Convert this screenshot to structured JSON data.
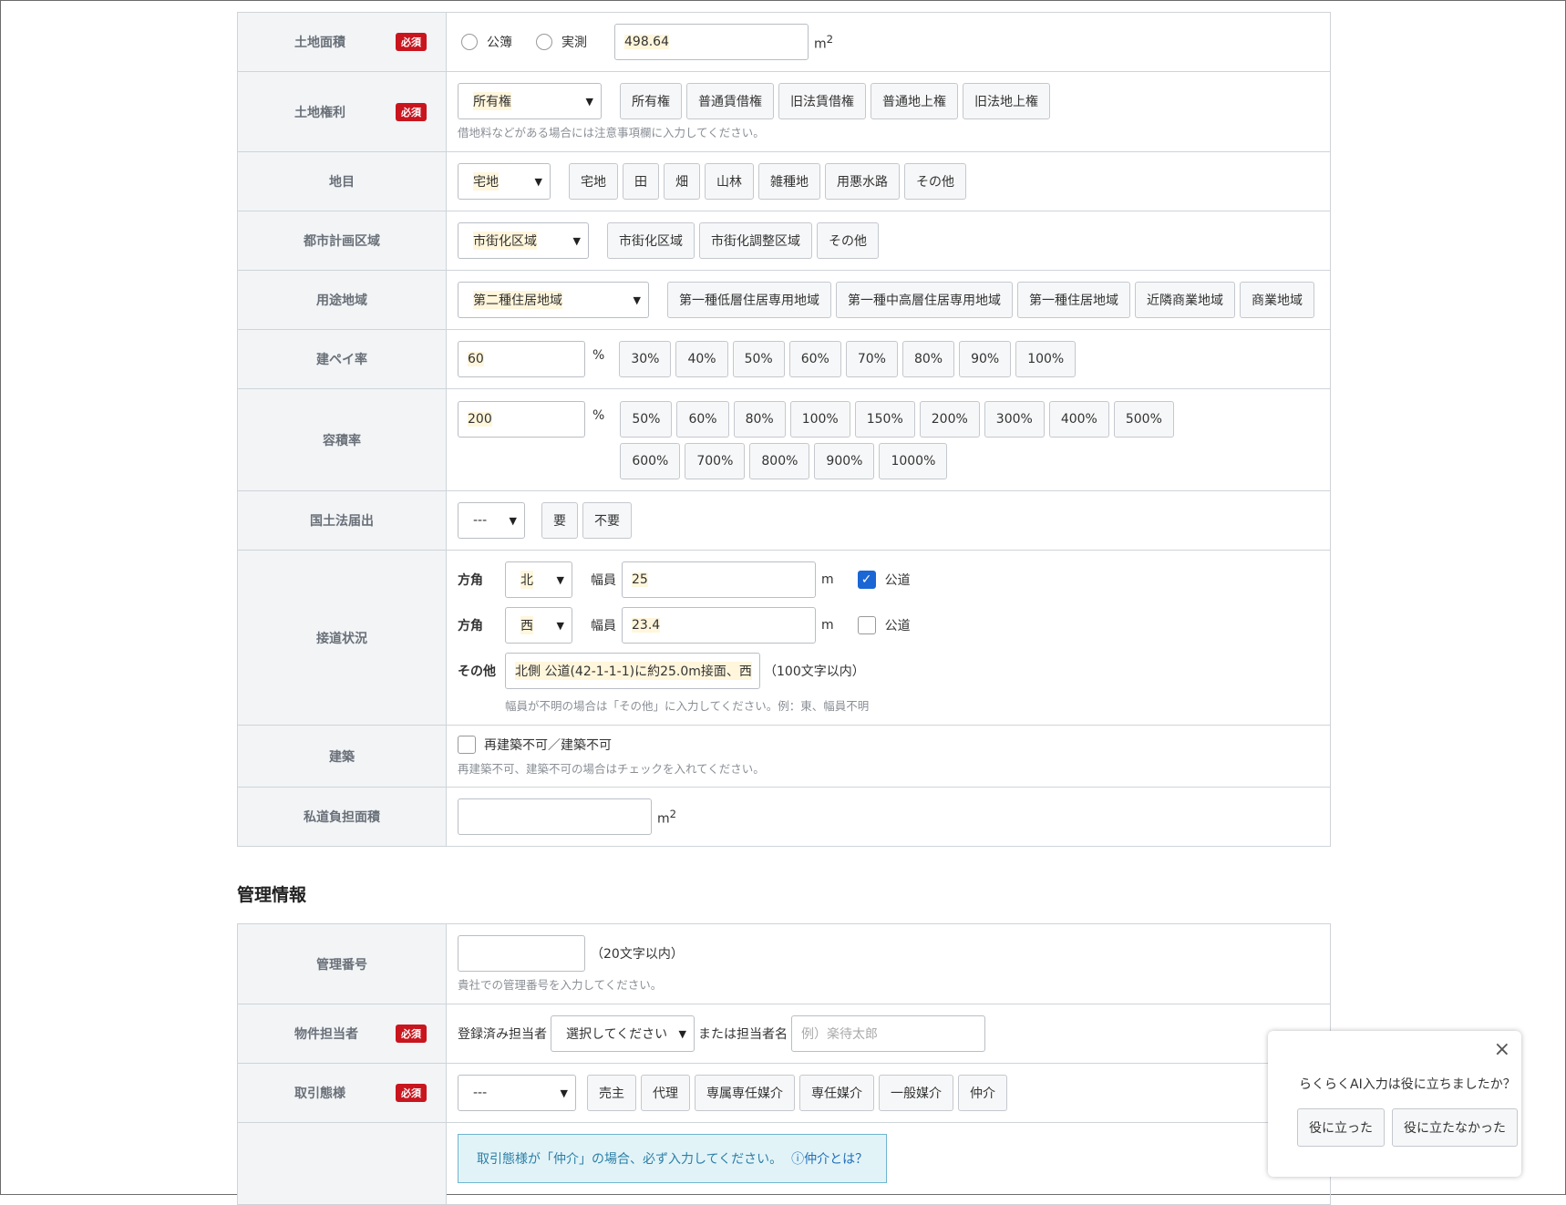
{
  "rows": {
    "land_area": {
      "label": "土地面積",
      "required": "必須",
      "radio_public": "公簿",
      "radio_actual": "実測",
      "value": "498.64",
      "unit_m": "m",
      "unit_sup": "2"
    },
    "land_rights": {
      "label": "土地権利",
      "required": "必須",
      "selected": "所有権",
      "buttons": [
        "所有権",
        "普通賃借権",
        "旧法賃借権",
        "普通地上権",
        "旧法地上権"
      ],
      "help": "借地料などがある場合には注意事項欄に入力してください。"
    },
    "land_category": {
      "label": "地目",
      "selected": "宅地",
      "buttons": [
        "宅地",
        "田",
        "畑",
        "山林",
        "雑種地",
        "用悪水路",
        "その他"
      ]
    },
    "city_planning": {
      "label": "都市計画区域",
      "selected": "市街化区域",
      "buttons": [
        "市街化区域",
        "市街化調整区域",
        "その他"
      ]
    },
    "zoning": {
      "label": "用途地域",
      "selected": "第二種住居地域",
      "buttons": [
        "第一種低層住居専用地域",
        "第一種中高層住居専用地域",
        "第一種住居地域",
        "近隣商業地域",
        "商業地域"
      ]
    },
    "coverage": {
      "label": "建ペイ率",
      "value": "60",
      "unit": "%",
      "buttons": [
        "30%",
        "40%",
        "50%",
        "60%",
        "70%",
        "80%",
        "90%",
        "100%"
      ]
    },
    "far": {
      "label": "容積率",
      "value": "200",
      "unit": "%",
      "buttons_row1": [
        "50%",
        "60%",
        "80%",
        "100%",
        "150%",
        "200%",
        "300%",
        "400%",
        "500%"
      ],
      "buttons_row2": [
        "600%",
        "700%",
        "800%",
        "900%",
        "1000%"
      ]
    },
    "notification": {
      "label": "国土法届出",
      "selected": "---",
      "buttons": [
        "要",
        "不要"
      ]
    },
    "road": {
      "label": "接道状況",
      "direction_label": "方角",
      "width_label": "幅員",
      "unit": "m",
      "public_label": "公道",
      "road1": {
        "direction": "北",
        "width": "25"
      },
      "road2": {
        "direction": "西",
        "width": "23.4"
      },
      "other_label": "その他",
      "other_value": "北側 公道(42-1-1-1)に約25.0m接面、西",
      "other_limit": "（100文字以内）",
      "help": "幅員が不明の場合は「その他」に入力してください。例：東、幅員不明"
    },
    "building": {
      "label": "建築",
      "checkbox_label": "再建築不可／建築不可",
      "help": "再建築不可、建築不可の場合はチェックを入れてください。"
    },
    "private_road": {
      "label": "私道負担面積",
      "unit_m": "m",
      "unit_sup": "2"
    }
  },
  "management": {
    "title": "管理情報",
    "number": {
      "label": "管理番号",
      "limit": "（20文字以内）",
      "help": "貴社での管理番号を入力してください。"
    },
    "staff": {
      "label": "物件担当者",
      "required": "必須",
      "registered_label": "登録済み担当者",
      "select_placeholder": "選択してください",
      "or_label": "または担当者名",
      "name_placeholder": "例）楽待太郎"
    },
    "transaction": {
      "label": "取引態様",
      "required": "必須",
      "selected": "---",
      "buttons": [
        "売主",
        "代理",
        "専属専任媒介",
        "専任媒介",
        "一般媒介",
        "仲介"
      ]
    },
    "info": {
      "text": "取引態様が「仲介」の場合、必ず入力してください。",
      "link": "ⓘ仲介とは？"
    }
  },
  "popup": {
    "close": "×",
    "question": "らくらくAI入力は役に立ちましたか？",
    "yes": "役に立った",
    "no": "役に立たなかった"
  }
}
